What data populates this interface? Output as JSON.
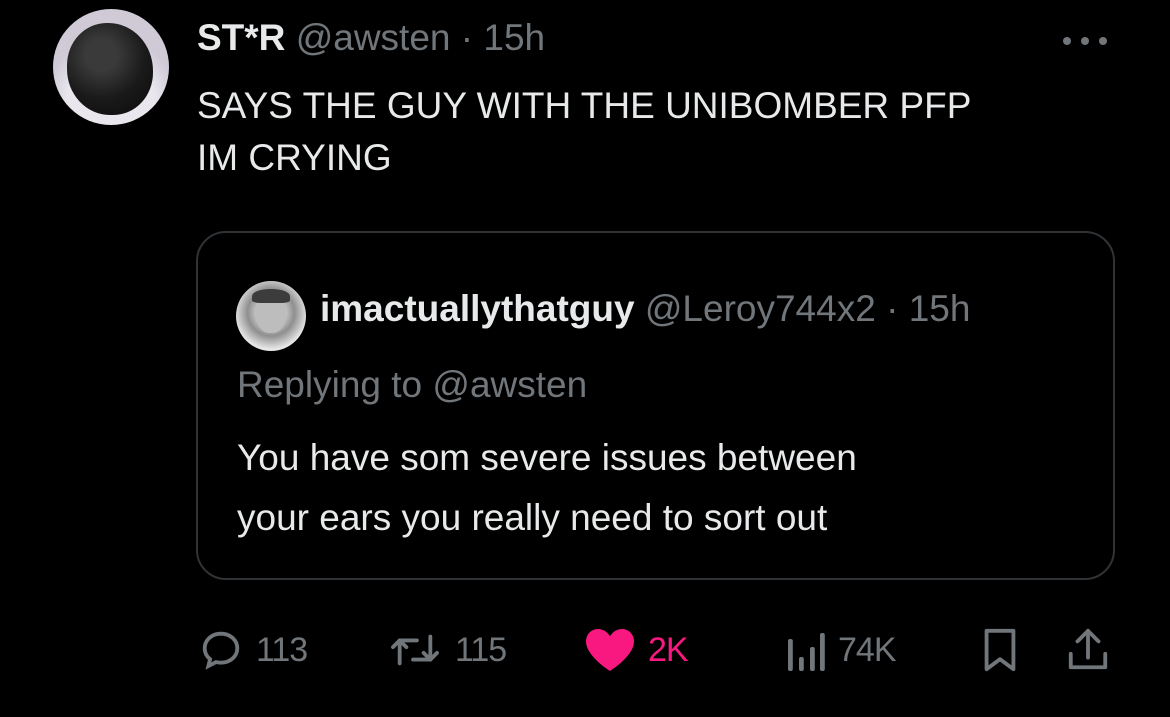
{
  "tweet": {
    "display_name": "ST*R",
    "handle": "@awsten",
    "separator": "·",
    "time": "15h",
    "text_lines": [
      "SAYS THE GUY WITH THE UNIBOMBER PFP",
      "IM CRYING"
    ],
    "more_icon": "more-horizontal-icon"
  },
  "quote": {
    "display_name": "imactuallythatguy",
    "handle": "@Leroy744x2",
    "separator": "·",
    "time": "15h",
    "replying_to": "Replying to @awsten",
    "text_lines": [
      "You have som severe issues between",
      "your ears you really need to sort out"
    ]
  },
  "actions": {
    "replies": "113",
    "retweets": "115",
    "likes": "2K",
    "views": "74K",
    "like_color": "#f91880",
    "muted_color": "#71767b"
  }
}
